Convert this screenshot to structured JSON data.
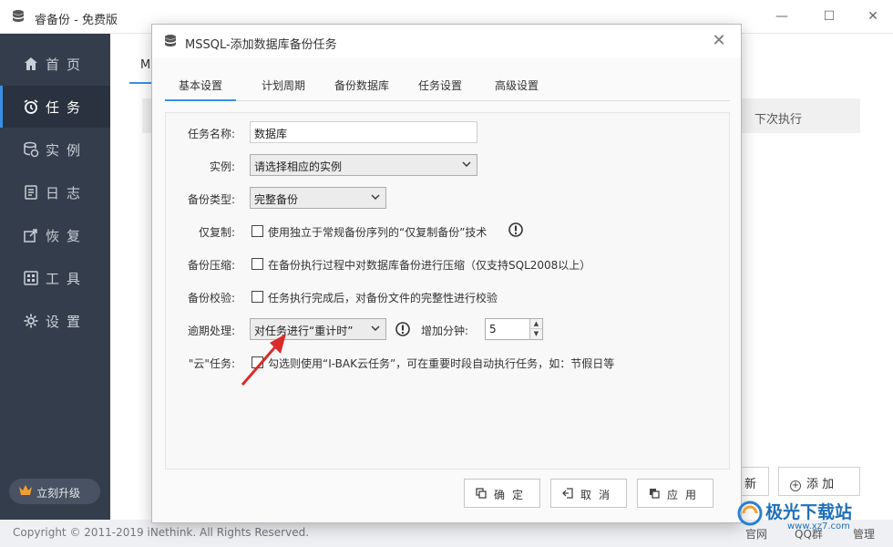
{
  "app": {
    "title": "睿备份 - 免费版",
    "window_controls": {
      "minimize": "—",
      "maximize": "☐",
      "close": "✕"
    }
  },
  "sidebar": {
    "items": [
      {
        "label": "首页",
        "icon": "home-icon"
      },
      {
        "label": "任务",
        "icon": "alarm-clock-icon",
        "active": true
      },
      {
        "label": "实例",
        "icon": "database-instance-icon"
      },
      {
        "label": "日志",
        "icon": "log-icon"
      },
      {
        "label": "恢复",
        "icon": "restore-icon"
      },
      {
        "label": "工具",
        "icon": "tools-icon"
      },
      {
        "label": "设置",
        "icon": "gear-icon"
      }
    ],
    "upgrade_label": "立刻升级"
  },
  "background": {
    "tab_partial": "M",
    "header_col": "下次执行",
    "btn_new_partial": "新",
    "btn_add": "添 加"
  },
  "footer": {
    "copyright": "Copyright © 2011-2019 iNethink. All Rights Reserved.",
    "link1": "官网",
    "link2": "QQ群",
    "link3": "管理"
  },
  "dialog": {
    "title": "MSSQL-添加数据库备份任务",
    "tabs": [
      "基本设置",
      "计划周期",
      "备份数据库",
      "任务设置",
      "高级设置"
    ],
    "form": {
      "task_name_label": "任务名称:",
      "task_name_value": "数据库",
      "instance_label": "实例:",
      "instance_value": "请选择相应的实例",
      "backup_type_label": "备份类型:",
      "backup_type_value": "完整备份",
      "copy_only_label": "仅复制:",
      "copy_only_text": "使用独立于常规备份序列的“仅复制备份”技术",
      "compress_label": "备份压缩:",
      "compress_text": "在备份执行过程中对数据库备份进行压缩（仅支持SQL2008以上）",
      "verify_label": "备份校验:",
      "verify_text": "任务执行完成后，对备份文件的完整性进行校验",
      "overdue_label": "逾期处理:",
      "overdue_value": "对任务进行“重计时”",
      "add_minutes_label": "增加分钟:",
      "add_minutes_value": "5",
      "cloud_label": "\"云\"任务:",
      "cloud_text": "勾选则使用“I-BAK云任务”，可在重要时段自动执行任务，如：节假日等"
    },
    "buttons": {
      "ok": "确定",
      "cancel": "取消",
      "apply": "应用"
    }
  },
  "watermark": {
    "brand": "极光下载站",
    "url": "www.xz7.com"
  },
  "colors": {
    "sidebar_bg": "#343d4b",
    "accent": "#3a8ee6",
    "arrow": "#d92b2b"
  }
}
